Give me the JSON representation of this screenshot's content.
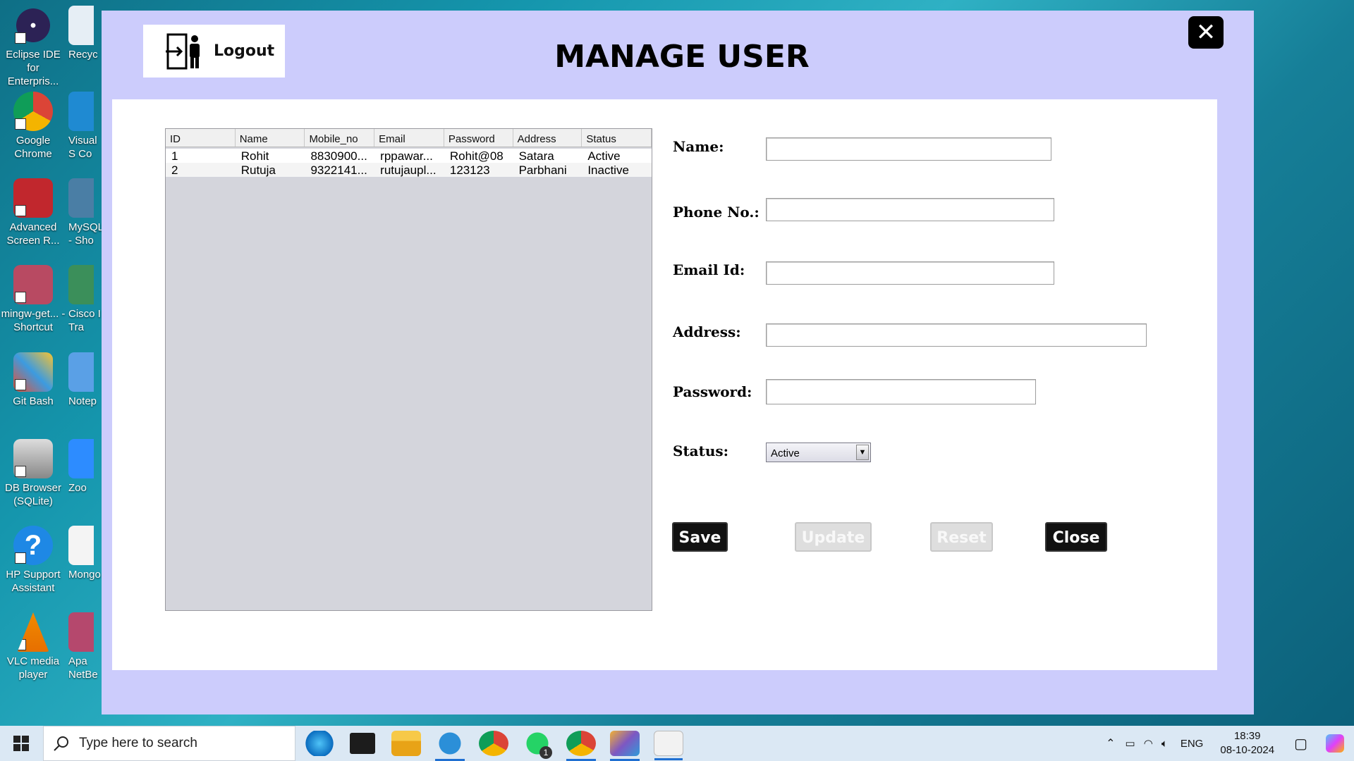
{
  "desktop": {
    "icons": [
      {
        "label": "Eclipse IDE for Enterpris..."
      },
      {
        "label": "Google Chrome"
      },
      {
        "label": "Advanced Screen R..."
      },
      {
        "label": "mingw-get... - Shortcut"
      },
      {
        "label": "Git Bash"
      },
      {
        "label": "DB Browser (SQLite)"
      },
      {
        "label": "HP Support Assistant"
      },
      {
        "label": "VLC media player"
      }
    ],
    "icons_col2": [
      {
        "label": "Recyc"
      },
      {
        "label": "Visual S Co"
      },
      {
        "label": "MySQL - Sho"
      },
      {
        "label": "Cisco I Tra"
      },
      {
        "label": "Notep"
      },
      {
        "label": "Zoo"
      },
      {
        "label": "Mongo"
      },
      {
        "label": "Apa NetBe"
      }
    ]
  },
  "app": {
    "logout_label": "Logout",
    "title": "MANAGE USER",
    "close_glyph": "✕",
    "table": {
      "columns": [
        "ID",
        "Name",
        "Mobile_no",
        "Email",
        "Password",
        "Address",
        "Status"
      ],
      "rows": [
        [
          "1",
          "Rohit",
          "8830900...",
          "rppawar...",
          "Rohit@08",
          "Satara",
          "Active"
        ],
        [
          "2",
          "Rutuja",
          "9322141...",
          "rutujaupl...",
          "123123",
          "Parbhani",
          "Inactive"
        ]
      ]
    },
    "form": {
      "name_label": "Name:",
      "name_value": "",
      "phone_label": "Phone No.:",
      "phone_value": "",
      "email_label": "Email Id:",
      "email_value": "",
      "address_label": "Address:",
      "address_value": "",
      "password_label": "Password:",
      "password_value": "",
      "status_label": "Status:",
      "status_value": "Active"
    },
    "buttons": {
      "save": "Save",
      "update": "Update",
      "reset": "Reset",
      "close": "Close"
    }
  },
  "taskbar": {
    "search_placeholder": "Type here to search",
    "whatsapp_badge": "1",
    "language": "ENG",
    "time": "18:39",
    "date": "08-10-2024"
  },
  "colors": {
    "window_bg": "#ccccfc",
    "panel_bg": "#ffffff",
    "dark_button": "#111111",
    "disabled_button": "#dedede"
  }
}
